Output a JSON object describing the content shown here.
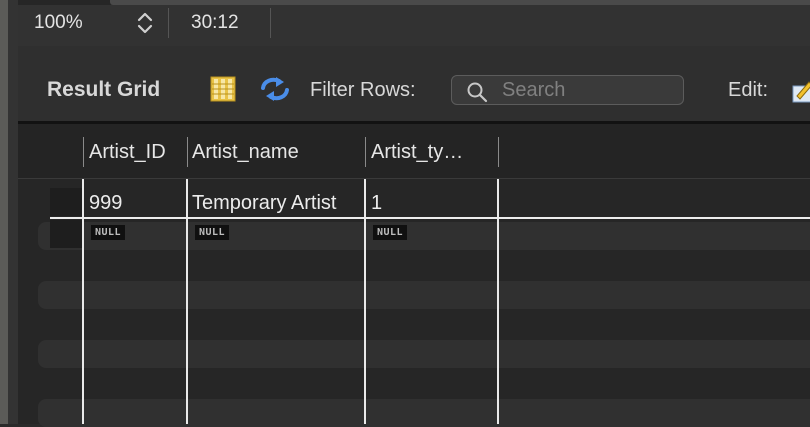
{
  "status_bar": {
    "zoom": "100%",
    "cursor_position": "30:12"
  },
  "toolbar": {
    "result_grid_label": "Result Grid",
    "filter_rows_label": "Filter Rows:",
    "search_placeholder": "Search",
    "edit_label": "Edit:"
  },
  "grid": {
    "columns": [
      "Artist_ID",
      "Artist_name",
      "Artist_ty…"
    ],
    "rows": [
      [
        "999",
        "Temporary Artist",
        "1"
      ],
      [
        "NULL",
        "NULL",
        "NULL"
      ]
    ]
  },
  "colors": {
    "background": "#2a2a2a",
    "grid_lines": "#e9e9e9",
    "refresh_icon": "#4a8de8",
    "grid_icon": "#e8c246"
  }
}
